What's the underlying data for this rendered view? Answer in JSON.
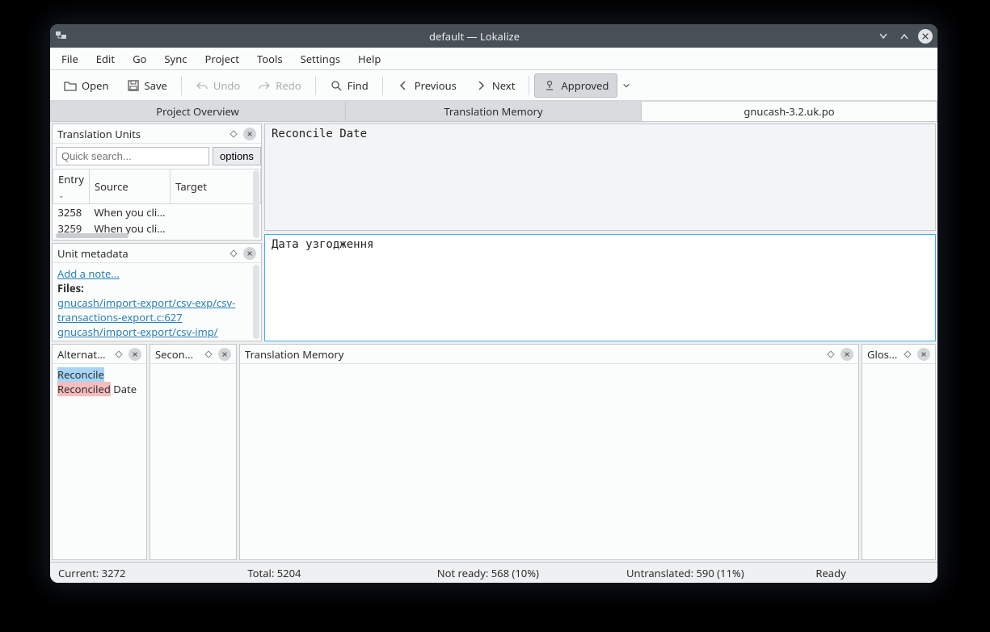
{
  "titlebar": {
    "title": "default — Lokalize"
  },
  "menu": [
    "File",
    "Edit",
    "Go",
    "Sync",
    "Project",
    "Tools",
    "Settings",
    "Help"
  ],
  "toolbar": {
    "open": "Open",
    "save": "Save",
    "undo": "Undo",
    "redo": "Redo",
    "find": "Find",
    "prev": "Previous",
    "next": "Next",
    "approved": "Approved"
  },
  "tabs": [
    "Project Overview",
    "Translation Memory",
    "gnucash-3.2.uk.po"
  ],
  "tu_panel": {
    "title": "Translation Units",
    "search_placeholder": "Quick search...",
    "options_label": "options",
    "columns": {
      "entry": "Entry",
      "source": "Source",
      "target": "Target"
    },
    "rows": [
      {
        "entry": "3258",
        "source": "When you cli..."
      },
      {
        "entry": "3259",
        "source": "When you cli..."
      }
    ]
  },
  "meta_panel": {
    "title": "Unit metadata",
    "add_note": "Add a note...",
    "files_label": "Files:",
    "file_links": [
      "gnucash/import-export/csv-exp/csv-transactions-export.c:627",
      "gnucash/import-export/csv-imp/"
    ]
  },
  "editor": {
    "source_text": "Reconcile Date",
    "target_text": "Дата узгодження"
  },
  "bottom": {
    "alt_title": "Alternat...",
    "alt_line1_hl": "Reconcile",
    "alt_line2_hl": "Reconciled",
    "alt_line2_rest": " Date",
    "second_title": "Secon...",
    "tm_title": "Translation Memory",
    "glos_title": "Glos..."
  },
  "status": {
    "current": "Current: 3272",
    "total": "Total: 5204",
    "not_ready": "Not ready: 568 (10%)",
    "untranslated": "Untranslated: 590 (11%)",
    "ready": "Ready"
  }
}
